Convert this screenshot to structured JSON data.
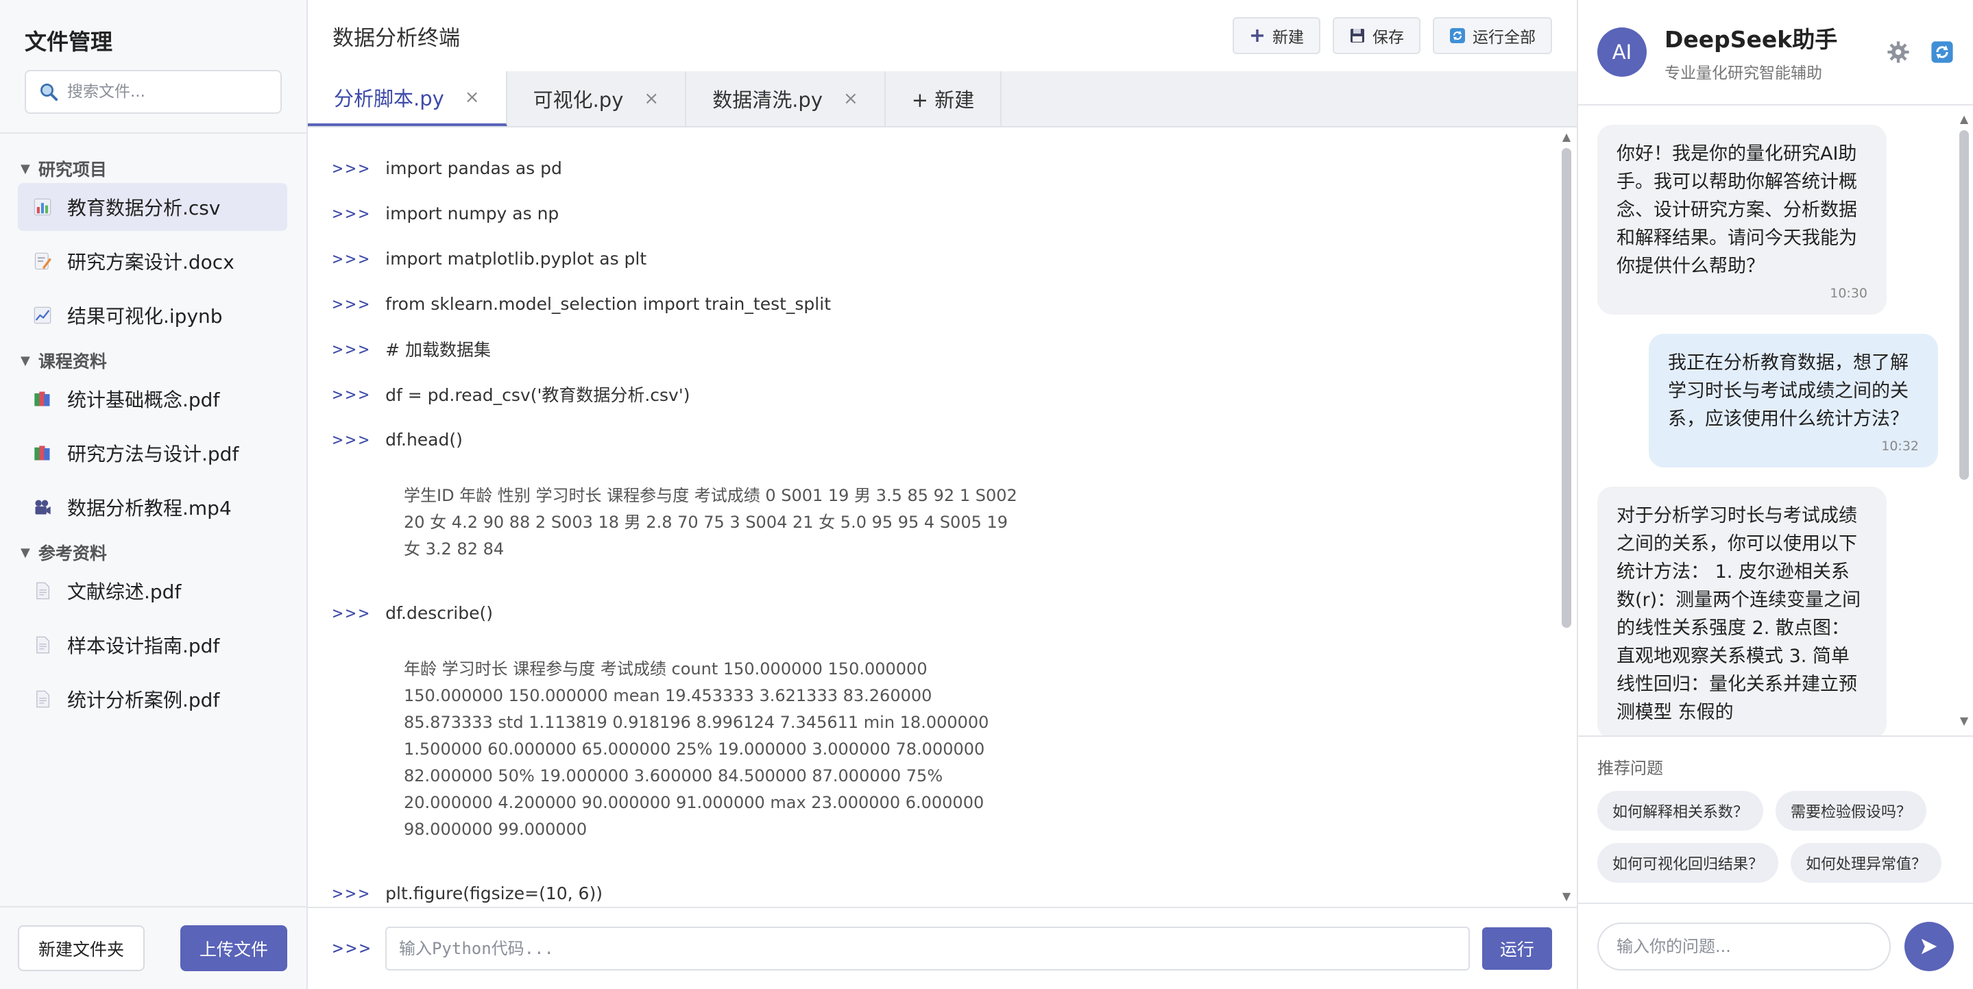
{
  "sidebar": {
    "title": "文件管理",
    "search_placeholder": "搜索文件...",
    "folders": [
      {
        "name": "研究项目",
        "files": [
          "教育数据分析.csv",
          "研究方案设计.docx",
          "结果可视化.ipynb"
        ]
      },
      {
        "name": "课程资料",
        "files": [
          "统计基础概念.pdf",
          "研究方法与设计.pdf",
          "数据分析教程.mp4"
        ]
      },
      {
        "name": "参考资料",
        "files": [
          "文献综述.pdf",
          "样本设计指南.pdf",
          "统计分析案例.pdf"
        ]
      }
    ],
    "new_folder_label": "新建文件夹",
    "upload_label": "上传文件"
  },
  "main": {
    "title": "数据分析终端",
    "actions": {
      "new": "新建",
      "save": "保存",
      "run_all": "运行全部"
    },
    "tabs": [
      "分析脚本.py",
      "可视化.py",
      "数据清洗.py"
    ],
    "new_tab_label": "+ 新建",
    "prompt": ">>>",
    "lines": [
      "import pandas as pd",
      "import numpy as np",
      "import matplotlib.pyplot as plt",
      "from sklearn.model_selection import train_test_split",
      "# 加载数据集",
      "df = pd.read_csv('教育数据分析.csv')",
      "df.head()"
    ],
    "output_head": "学生ID 年龄 性别 学习时长 课程参与度 考试成绩 0 S001 19 男 3.5 85 92 1 S002 20 女 4.2 90 88 2 S003 18 男 2.8 70 75 3 S004 21 女 5.0 95 95 4 S005 19 女 3.2 82 84",
    "line_describe": "df.describe()",
    "output_describe": "年龄 学习时长 课程参与度 考试成绩 count 150.000000 150.000000 150.000000 150.000000 mean 19.453333 3.621333 83.260000 85.873333 std 1.113819 0.918196 8.996124 7.345611 min 18.000000 1.500000 60.000000 65.000000 25% 19.000000 3.000000 78.000000 82.000000 50% 19.000000 3.600000 84.500000 87.000000 75% 20.000000 4.200000 90.000000 91.000000 max 23.000000 6.000000 98.000000 99.000000",
    "line_partial": "plt.figure(figsize=(10, 6))",
    "input_placeholder": "输入Python代码...",
    "run_label": "运行"
  },
  "chat": {
    "avatar": "AI",
    "name": "DeepSeek助手",
    "subtitle": "专业量化研究智能辅助",
    "messages": [
      {
        "role": "ai",
        "text": "你好！我是你的量化研究AI助手。我可以帮助你解答统计概念、设计研究方案、分析数据和解释结果。请问今天我能为你提供什么帮助？",
        "time": "10:30"
      },
      {
        "role": "user",
        "text": "我正在分析教育数据，想了解学习时长与考试成绩之间的关系，应该使用什么统计方法？",
        "time": "10:32"
      },
      {
        "role": "ai",
        "text": "对于分析学习时长与考试成绩之间的关系，你可以使用以下统计方法： 1. 皮尔逊相关系数(r)：测量两个连续变量之间的线性关系强度 2. 散点图：直观地观察关系模式 3. 简单线性回归：量化关系并建立预测模型 东假的"
      }
    ],
    "suggest_label": "推荐问题",
    "suggestions": [
      "如何解释相关系数？",
      "需要检验假设吗？",
      "如何可视化回归结果？",
      "如何处理异常值？"
    ],
    "input_placeholder": "输入你的问题..."
  },
  "colors": {
    "accent": "#5a64b8",
    "user_bubble": "#e3eefb",
    "ai_bubble": "#f1f2f5"
  }
}
